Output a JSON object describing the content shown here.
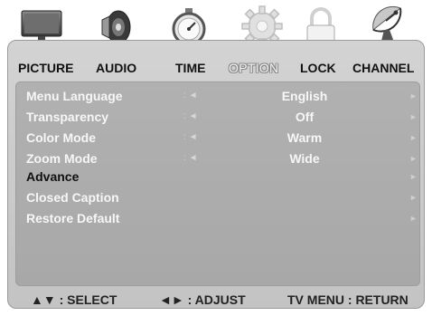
{
  "tabs": [
    {
      "label": "PICTURE",
      "icon": "tv-icon"
    },
    {
      "label": "AUDIO",
      "icon": "speaker-icon"
    },
    {
      "label": "TIME",
      "icon": "stopwatch-icon"
    },
    {
      "label": "OPTION",
      "icon": "gear-icon",
      "active": true
    },
    {
      "label": "LOCK",
      "icon": "padlock-icon"
    },
    {
      "label": "CHANNEL",
      "icon": "satellite-dish-icon"
    }
  ],
  "menu": {
    "items": [
      {
        "label": "Menu Language",
        "separator": ":",
        "left_arrow": "◄",
        "value": "English",
        "right_arrow": "►"
      },
      {
        "label": "Transparency",
        "separator": ":",
        "left_arrow": "◄",
        "value": "Off",
        "right_arrow": "►"
      },
      {
        "label": "Color Mode",
        "separator": ":",
        "left_arrow": "◄",
        "value": "Warm",
        "right_arrow": "►"
      },
      {
        "label": "Zoom Mode",
        "separator": ":",
        "left_arrow": "◄",
        "value": "Wide",
        "right_arrow": "►"
      },
      {
        "label": "Advance",
        "right_arrow": "►",
        "highlighted": true
      },
      {
        "label": "Closed Caption",
        "right_arrow": "►"
      },
      {
        "label": "Restore Default",
        "right_arrow": "►"
      }
    ]
  },
  "footer": {
    "select_hint": "▲▼ : SELECT",
    "adjust_hint": "◄► : ADJUST",
    "return_hint": "TV MENU : RETURN"
  },
  "colors": {
    "frame": "#cfcfcf",
    "panel": "#adadad",
    "text_light": "#f6f6f6",
    "text_dark": "#111111"
  }
}
